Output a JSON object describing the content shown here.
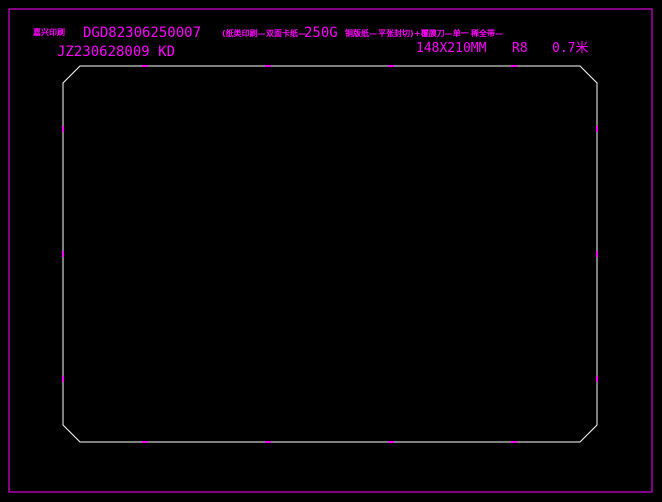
{
  "header": {
    "company": "嘉兴印刷",
    "order_no": "DGD82306250007",
    "spec_part1": "(纸类印刷—",
    "spec_part2": "双面卡纸—",
    "paper_weight": "250G",
    "spec_part3": "铜版纸—",
    "spec_part4": "平张封切)",
    "spec_part5": "+覆膜刀—单一",
    "spec_part6": "稀全带—",
    "job_no": "JZ230628009 KD",
    "size": "148X210MM",
    "radius": "R8",
    "thickness": "0.7米"
  },
  "colors": {
    "background": "#000000",
    "frame": "#ff00ff",
    "dieline": "#ffffff",
    "marker": "#ff00ff"
  }
}
